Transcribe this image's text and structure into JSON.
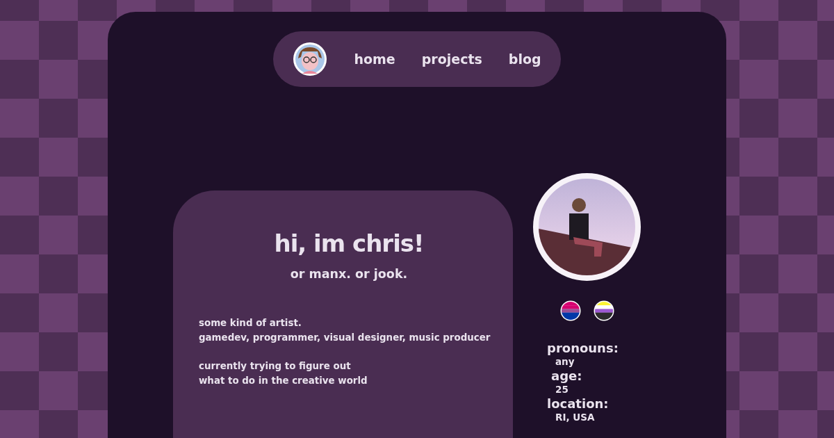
{
  "nav": {
    "links": [
      "home",
      "projects",
      "blog"
    ]
  },
  "intro": {
    "title": "hi, im chris!",
    "subtitle": "or manx. or jook.",
    "paragraphs": [
      [
        "some kind of artist.",
        "gamedev, programmer, visual designer, music producer"
      ],
      [
        "currently trying to figure out",
        "what to do in the creative world"
      ]
    ]
  },
  "profile": {
    "flags": [
      {
        "kind": "bisexual"
      },
      {
        "kind": "nonbinary"
      }
    ],
    "facts": [
      {
        "label": "pronouns:",
        "value": "any"
      },
      {
        "label": "age:",
        "value": "25"
      },
      {
        "label": "location:",
        "value": "RI, USA"
      }
    ]
  }
}
